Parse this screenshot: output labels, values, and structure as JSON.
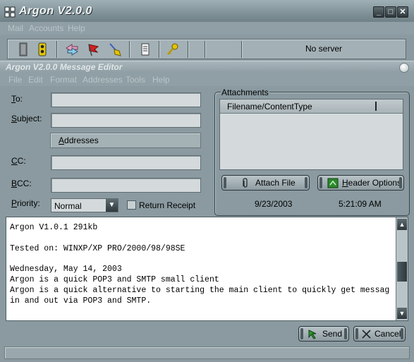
{
  "app": {
    "title": "Argon V2.0.0",
    "window_controls": {
      "minimize": "_",
      "maximize": "□",
      "close": "✕"
    }
  },
  "main_menu": [
    "Mail",
    "Accounts",
    "Help"
  ],
  "toolbar": {
    "icons": [
      "door-icon",
      "traffic-light-icon",
      "refresh-arrows-icon",
      "flag-icon",
      "broom-icon",
      "notepad-icon",
      "key-icon"
    ],
    "status": "No server"
  },
  "editor": {
    "title": "Argon V2.0.0  Message Editor",
    "menu": [
      "File",
      "Edit",
      "Format",
      "Addresses",
      "Tools",
      "Help"
    ],
    "to_label": "To:",
    "to_value": "",
    "subject_label": "Subject:",
    "subject_value": "",
    "addresses_button": "Addresses",
    "cc_label": "CC:",
    "cc_value": "",
    "bcc_label": "BCC:",
    "bcc_value": "",
    "priority_label": "Priority:",
    "priority_value": "Normal",
    "return_receipt_label": "Return Receipt",
    "return_receipt_checked": false
  },
  "attachments": {
    "legend": "Attachments",
    "column": "Filename/ContentType",
    "attach_file_button": "Attach File",
    "header_options_button": "Header Options",
    "date": "9/23/2003",
    "time": "5:21:09 AM"
  },
  "message_body": "Argon V1.0.1 291kb\n\nTested on: WINXP/XP PRO/2000/98/98SE\n\nWednesday, May 14, 2003\nArgon is a quick POP3 and SMTP small client\nArgon is a quick alternative to starting the main client to quickly get messag\nin and out via POP3 and SMTP.",
  "actions": {
    "send_button": "Send",
    "cancel_button": "Cancel"
  },
  "colors": {
    "chrome": "#8a9aa0",
    "field": "#d4dadc",
    "send_arrow": "#2e9e2e"
  }
}
